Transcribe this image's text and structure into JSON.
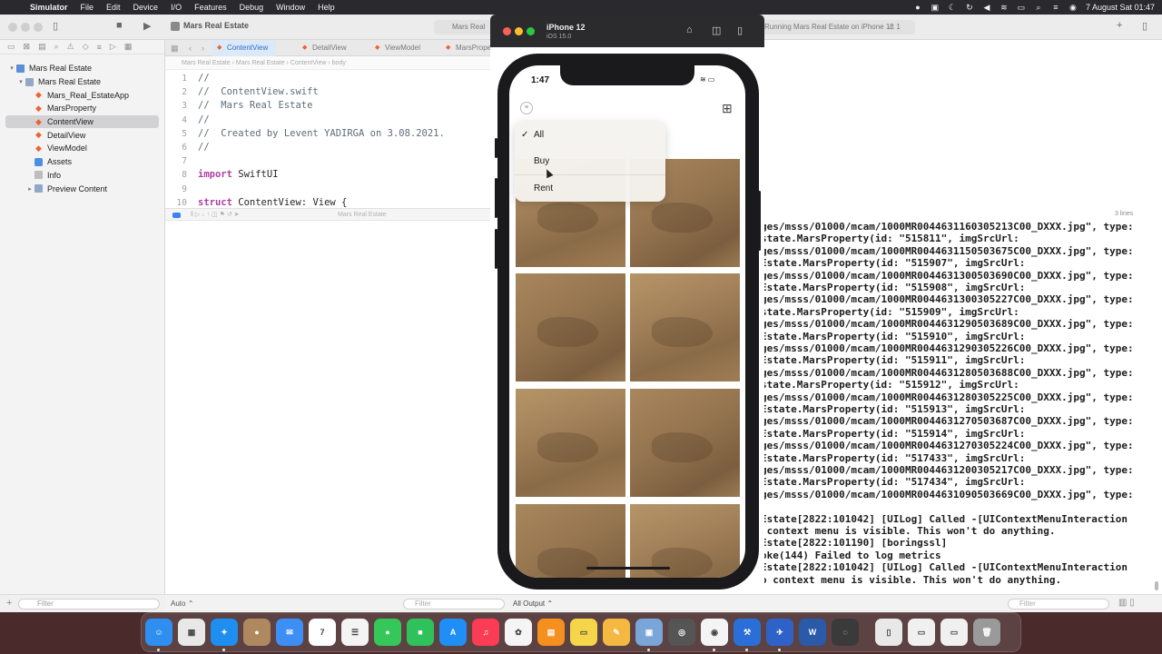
{
  "menubar": {
    "app": "Simulator",
    "items": [
      "File",
      "Edit",
      "Device",
      "I/O",
      "Features",
      "Debug",
      "Window",
      "Help"
    ],
    "clock": "7 August Sat  01:47"
  },
  "xcode": {
    "scheme": "Mars Real Estate",
    "status_left": "Mars Real",
    "status_right": "Running Mars Real Estate on iPhone 12",
    "warning_count": "1",
    "tabs": [
      "ContentView",
      "DetailView",
      "ViewModel",
      "MarsPrope"
    ],
    "breadcrumb": [
      "Mars Real Estate",
      "Mars Real Estate",
      "ContentView",
      "body"
    ],
    "navigator": {
      "items": [
        {
          "label": "Mars Real Estate",
          "kind": "project",
          "indent": 0,
          "disclosure": "▾"
        },
        {
          "label": "Mars Real Estate",
          "kind": "folder",
          "indent": 1,
          "disclosure": "▾"
        },
        {
          "label": "Mars_Real_EstateApp",
          "kind": "swift",
          "indent": 2,
          "disclosure": ""
        },
        {
          "label": "MarsProperty",
          "kind": "swift",
          "indent": 2,
          "disclosure": ""
        },
        {
          "label": "ContentView",
          "kind": "swift",
          "indent": 2,
          "disclosure": "",
          "selected": true
        },
        {
          "label": "DetailView",
          "kind": "swift",
          "indent": 2,
          "disclosure": ""
        },
        {
          "label": "ViewModel",
          "kind": "swift",
          "indent": 2,
          "disclosure": ""
        },
        {
          "label": "Assets",
          "kind": "assets",
          "indent": 2,
          "disclosure": ""
        },
        {
          "label": "Info",
          "kind": "plist",
          "indent": 2,
          "disclosure": ""
        },
        {
          "label": "Preview Content",
          "kind": "folder",
          "indent": 2,
          "disclosure": "▸"
        }
      ],
      "filter_placeholder": "Filter"
    },
    "code_lines": [
      {
        "n": "1",
        "text": "//",
        "kind": "comment"
      },
      {
        "n": "2",
        "text": "//  ContentView.swift",
        "kind": "comment"
      },
      {
        "n": "3",
        "text": "//  Mars Real Estate",
        "kind": "comment"
      },
      {
        "n": "4",
        "text": "//",
        "kind": "comment"
      },
      {
        "n": "5",
        "text": "//  Created by Levent YADIRGA on 3.08.2021.",
        "kind": "comment"
      },
      {
        "n": "6",
        "text": "//",
        "kind": "comment"
      },
      {
        "n": "7",
        "text": "",
        "kind": "plain"
      },
      {
        "n": "8",
        "kw": "import",
        "text": " SwiftUI",
        "kind": "import"
      },
      {
        "n": "9",
        "text": "",
        "kind": "plain"
      },
      {
        "n": "10",
        "kw": "struct",
        "text": " ContentView: View {",
        "kind": "import"
      }
    ],
    "debug_breadcrumb": "Mars Real Estate",
    "lines_count": "3 lines",
    "variables_scope": "Auto",
    "variables_filter": "Filter",
    "console_scope": "All Output",
    "console_filter": "Filter",
    "console_lines": [
      "ges/msss/01000/mcam/1000MR0044631160305213C00_DXXX.jpg\", type:",
      "state.MarsProperty(id: \"515811\", imgSrcUrl:",
      "ges/msss/01000/mcam/1000MR0044631150503675C00_DXXX.jpg\", type:",
      "Estate.MarsProperty(id: \"515907\", imgSrcUrl:",
      "ges/msss/01000/mcam/1000MR0044631300503690C00_DXXX.jpg\", type:",
      "Estate.MarsProperty(id: \"515908\", imgSrcUrl:",
      "ges/msss/01000/mcam/1000MR0044631300305227C00_DXXX.jpg\", type:",
      "state.MarsProperty(id: \"515909\", imgSrcUrl:",
      "ges/msss/01000/mcam/1000MR0044631290503689C00_DXXX.jpg\", type:",
      "Estate.MarsProperty(id: \"515910\", imgSrcUrl:",
      "ges/msss/01000/mcam/1000MR0044631290305226C00_DXXX.jpg\", type:",
      "Estate.MarsProperty(id: \"515911\", imgSrcUrl:",
      "ges/msss/01000/mcam/1000MR0044631280503688C00_DXXX.jpg\", type:",
      "state.MarsProperty(id: \"515912\", imgSrcUrl:",
      "ges/msss/01000/mcam/1000MR0044631280305225C00_DXXX.jpg\", type:",
      "Estate.MarsProperty(id: \"515913\", imgSrcUrl:",
      "ges/msss/01000/mcam/1000MR0044631270503687C00_DXXX.jpg\", type:",
      "Estate.MarsProperty(id: \"515914\", imgSrcUrl:",
      "ges/msss/01000/mcam/1000MR0044631270305224C00_DXXX.jpg\", type:",
      "Estate.MarsProperty(id: \"517433\", imgSrcUrl:",
      "ges/msss/01000/mcam/1000MR0044631200305217C00_DXXX.jpg\", type:",
      "Estate.MarsProperty(id: \"517434\", imgSrcUrl:",
      "ges/msss/01000/mcam/1000MR0044631090503669C00_DXXX.jpg\", type:",
      "",
      "Estate[2822:101042] [UILog] Called -[UIContextMenuInteraction",
      " context menu is visible. This won't do anything.",
      "Estate[2822:101190] [boringssl]",
      "oke(144) Failed to log metrics",
      "Estate[2822:101042] [UILog] Called -[UIContextMenuInteraction",
      "o context menu is visible. This won't do anything."
    ]
  },
  "simulator": {
    "device": "iPhone 12",
    "os": "iOS 15.0",
    "status_time": "1:47",
    "menu": {
      "items": [
        {
          "label": "All",
          "checked": true
        },
        {
          "label": "Buy",
          "checked": false
        },
        {
          "label": "Rent",
          "checked": false
        }
      ],
      "check_glyph": "✓"
    },
    "grid_tiles": 8
  },
  "dock": {
    "apps": [
      {
        "name": "Finder",
        "color": "#2f8ff0",
        "glyph": "☺"
      },
      {
        "name": "Launchpad",
        "color": "#e8e8e8",
        "glyph": "▦"
      },
      {
        "name": "Safari",
        "color": "#1e8ef0",
        "glyph": "✦"
      },
      {
        "name": "Contacts",
        "color": "#b08860",
        "glyph": "●"
      },
      {
        "name": "Mail",
        "color": "#3d8ef5",
        "glyph": "✉"
      },
      {
        "name": "Calendar",
        "color": "#ffffff",
        "glyph": "7"
      },
      {
        "name": "Reminders",
        "color": "#f4f4f4",
        "glyph": "☰"
      },
      {
        "name": "Messages",
        "color": "#35c759",
        "glyph": "●"
      },
      {
        "name": "FaceTime",
        "color": "#2fc25a",
        "glyph": "■"
      },
      {
        "name": "App Store",
        "color": "#1f8ef5",
        "glyph": "A"
      },
      {
        "name": "Music",
        "color": "#fa3d54",
        "glyph": "♫"
      },
      {
        "name": "Photos",
        "color": "#f5f5f5",
        "glyph": "✿"
      },
      {
        "name": "Books",
        "color": "#f5901e",
        "glyph": "▤"
      },
      {
        "name": "Notes",
        "color": "#f5d54a",
        "glyph": "▭"
      },
      {
        "name": "Pages",
        "color": "#f5b942",
        "glyph": "✎"
      },
      {
        "name": "Preview",
        "color": "#7aa5d8",
        "glyph": "▣"
      },
      {
        "name": "Screenshot",
        "color": "#555555",
        "glyph": "◎"
      },
      {
        "name": "Chrome",
        "color": "#f4f4f4",
        "glyph": "◉"
      },
      {
        "name": "Xcode",
        "color": "#2a6fd8",
        "glyph": "⚒"
      },
      {
        "name": "Simulator",
        "color": "#2f62c8",
        "glyph": "✈"
      },
      {
        "name": "Word",
        "color": "#2a5aa8",
        "glyph": "W"
      },
      {
        "name": "Instruments",
        "color": "#3a3a3a",
        "glyph": "◌"
      }
    ],
    "others": [
      {
        "name": "Document",
        "color": "#e8e8e8",
        "glyph": "▯"
      },
      {
        "name": "Downloads",
        "color": "#f0f0f0",
        "glyph": "▭"
      },
      {
        "name": "Screenshots",
        "color": "#f0f0f0",
        "glyph": "▭"
      },
      {
        "name": "Trash",
        "color": "#9a9a9a",
        "glyph": "🗑"
      }
    ]
  }
}
